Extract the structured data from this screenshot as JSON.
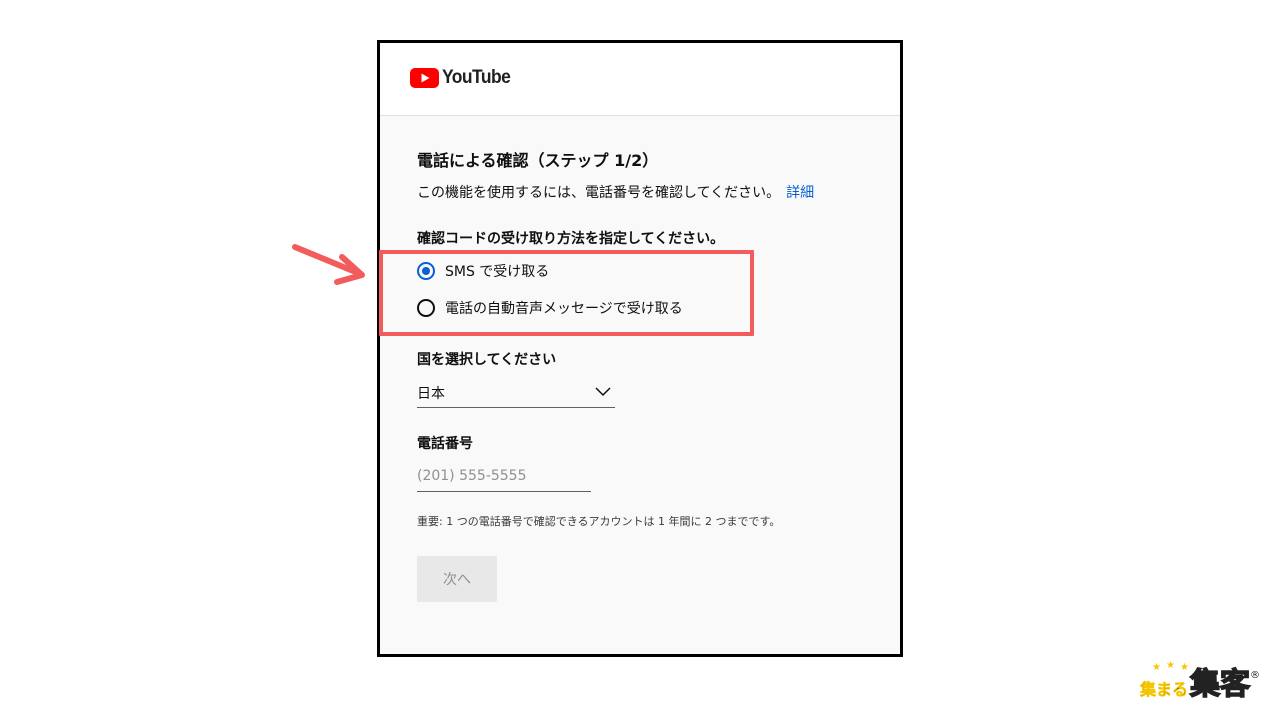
{
  "header": {
    "logo_text": "YouTube"
  },
  "page": {
    "title": "電話による確認（ステップ 1/2）",
    "description": "この機能を使用するには、電話番号を確認してください。",
    "details_link": "詳細",
    "method_label": "確認コードの受け取り方法を指定してください。",
    "methods": [
      {
        "label": "SMS で受け取る",
        "selected": true
      },
      {
        "label": "電話の自動音声メッセージで受け取る",
        "selected": false
      }
    ],
    "country_label": "国を選択してください",
    "country_value": "日本",
    "phone_label": "電話番号",
    "phone_placeholder": "(201) 555-5555",
    "phone_value": "",
    "note": "重要: 1 つの電話番号で確認できるアカウントは 1 年間に 2 つまでです。",
    "next_button": "次へ"
  },
  "annotation": {
    "highlight_color": "#f25c5c"
  },
  "branding": {
    "text_small": "集まる",
    "text_large": "集客",
    "registered": "®"
  },
  "colors": {
    "accent": "#065fd4",
    "youtube_red": "#ff0000"
  }
}
